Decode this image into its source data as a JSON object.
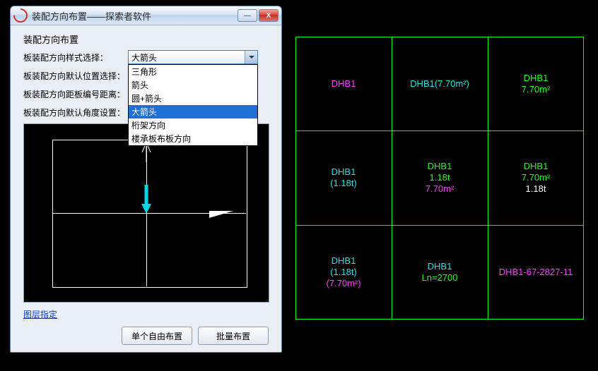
{
  "dialog": {
    "title": "装配方向布置——探索者软件",
    "section_title": "装配方向布置",
    "rows": {
      "style_label": "板装配方向样式选择：",
      "pos_label": "板装配方向默认位置选择：",
      "dist_label": "板装配方向距板编号距离：",
      "angle_label": "板装配方向默认角度设置："
    },
    "select": {
      "value": "大箭头",
      "options": [
        "三角形",
        "箭头",
        "圆+箭头",
        "大箭头",
        "桁架方向",
        "楼承板布板方向"
      ]
    },
    "link": "图层指定",
    "btn_single": "单个自由布置",
    "btn_batch": "批量布置",
    "win_min": "—",
    "win_close": "X"
  },
  "cad": {
    "c11": "DHB1",
    "c12": "DHB1(7.70m²)",
    "c13a": "DHB1",
    "c13b": "7.70m²",
    "c21a": "DHB1",
    "c21b": "(1.18t)",
    "c22a": "DHB1",
    "c22b": "1.18t",
    "c22c": "7.70m²",
    "c23a": "DHB1",
    "c23b": "7.70m²",
    "c23c": "1.18t",
    "c31a": "DHB1",
    "c31b": "(1.18t)",
    "c31c": "(7.70m²)",
    "c32a": "DHB1",
    "c32b": "Ln=2700",
    "c33": "DHB1-67-2827-11"
  }
}
